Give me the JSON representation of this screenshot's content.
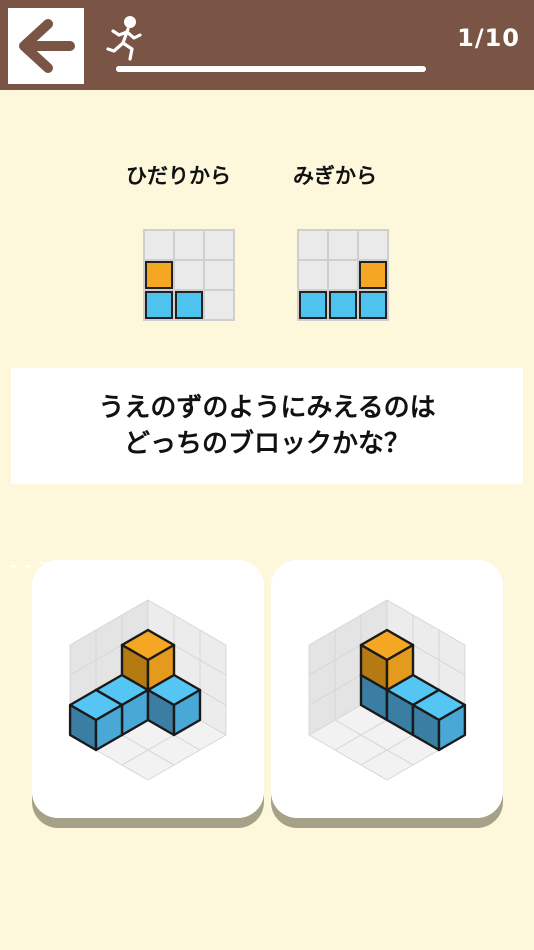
{
  "header": {
    "back_icon": "left-arrow-icon",
    "runner_icon": "running-person-icon",
    "progress": 0.1,
    "counter": "1/10"
  },
  "views": {
    "left_label": "ひだりから",
    "right_label": "みぎから",
    "left_grid": [
      [
        "empty",
        "empty",
        "empty"
      ],
      [
        "orange",
        "empty",
        "empty"
      ],
      [
        "blue",
        "blue",
        "empty"
      ]
    ],
    "right_grid": [
      [
        "empty",
        "empty",
        "empty"
      ],
      [
        "empty",
        "empty",
        "orange"
      ],
      [
        "blue",
        "blue",
        "blue"
      ]
    ]
  },
  "question": {
    "text": "うえのずのようにみえるのは\nどっちのブロックかな？"
  },
  "choices": [
    {
      "id": "a",
      "icon": "block-structure-option-a"
    },
    {
      "id": "b",
      "icon": "block-structure-option-b"
    }
  ],
  "colors": {
    "header_bg": "#7a5445",
    "page_bg": "#fdf8dc",
    "orange": "#f5a623",
    "blue": "#4fc3f0",
    "blue_dark": "#3a7fa3",
    "card_shadow": "#a6a289"
  }
}
